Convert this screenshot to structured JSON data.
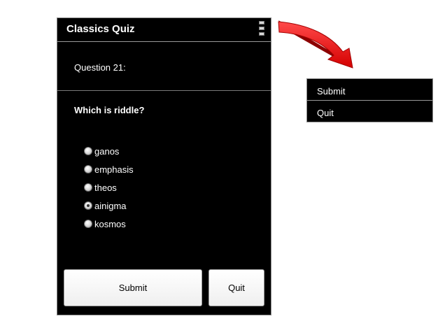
{
  "app": {
    "title": "Classics Quiz"
  },
  "question": {
    "number_label": "Question 21:",
    "text": "Which is riddle?",
    "options": [
      "ganos",
      "emphasis",
      "theos",
      "ainigma",
      "kosmos"
    ],
    "selected": "ainigma"
  },
  "buttons": {
    "submit": "Submit",
    "quit": "Quit"
  },
  "overflow_menu": {
    "items": [
      "Submit",
      "Quit"
    ]
  },
  "icons": {
    "overflow": "overflow-menu-icon",
    "arrow": "arrow-icon"
  },
  "colors": {
    "arrow": "#ee1111",
    "background": "#000000"
  }
}
